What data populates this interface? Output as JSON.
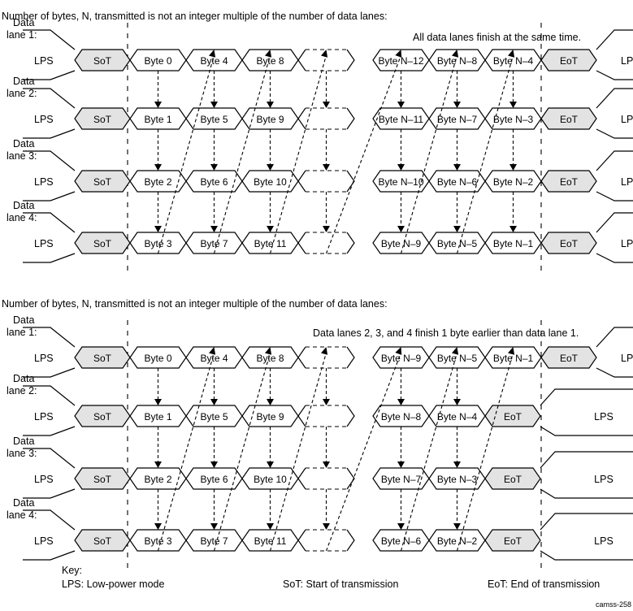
{
  "figure": {
    "id_label": "camss-258",
    "key_title": "Key:",
    "key_items": [
      "LPS: Low-power mode",
      "SoT: Start of transmission",
      "EoT: End of transmission"
    ]
  },
  "diagrams": [
    {
      "caption": "Number of bytes, N, transmitted is not an integer multiple of the number of data lanes:",
      "annotation": "All data lanes finish at the same time.",
      "lanes": [
        {
          "label_line1": "Data",
          "label_line2": "lane 1:",
          "lps_left": "LPS",
          "lps_right": "LPS",
          "sot": "SoT",
          "eot": "EoT",
          "bytes": [
            "Byte 0",
            "Byte 4",
            "Byte 8",
            "",
            "Byte N–12",
            "Byte N–8",
            "Byte N–4"
          ]
        },
        {
          "label_line1": "Data",
          "label_line2": "lane 2:",
          "lps_left": "LPS",
          "lps_right": "LPS",
          "sot": "SoT",
          "eot": "EoT",
          "bytes": [
            "Byte 1",
            "Byte 5",
            "Byte 9",
            "",
            "Byte N–11",
            "Byte N–7",
            "Byte N–3"
          ]
        },
        {
          "label_line1": "Data",
          "label_line2": "lane 3:",
          "lps_left": "LPS",
          "lps_right": "LPS",
          "sot": "SoT",
          "eot": "EoT",
          "bytes": [
            "Byte 2",
            "Byte 6",
            "Byte 10",
            "",
            "Byte N–10",
            "Byte N–6",
            "Byte N–2"
          ]
        },
        {
          "label_line1": "Data",
          "label_line2": "lane 4:",
          "lps_left": "LPS",
          "lps_right": "LPS",
          "sot": "SoT",
          "eot": "EoT",
          "bytes": [
            "Byte 3",
            "Byte 7",
            "Byte 11",
            "",
            "Byte N–9",
            "Byte N–5",
            "Byte N–1"
          ]
        }
      ]
    },
    {
      "caption": "Number of bytes, N, transmitted is not an integer multiple of the number of data lanes:",
      "annotation": "Data lanes 2, 3, and 4 finish 1 byte earlier than data lane 1.",
      "lanes": [
        {
          "label_line1": "Data",
          "label_line2": "lane 1:",
          "lps_left": "LPS",
          "lps_right": "LPS",
          "sot": "SoT",
          "eot": "EoT",
          "bytes": [
            "Byte 0",
            "Byte 4",
            "Byte 8",
            "",
            "Byte N–9",
            "Byte N–5",
            "Byte N–1"
          ]
        },
        {
          "label_line1": "Data",
          "label_line2": "lane 2:",
          "lps_left": "LPS",
          "lps_right": "LPS",
          "sot": "SoT",
          "eot": "EoT",
          "bytes": [
            "Byte 1",
            "Byte 5",
            "Byte 9",
            "",
            "Byte N–8",
            "Byte N–4"
          ]
        },
        {
          "label_line1": "Data",
          "label_line2": "lane 3:",
          "lps_left": "LPS",
          "lps_right": "LPS",
          "sot": "SoT",
          "eot": "EoT",
          "bytes": [
            "Byte 2",
            "Byte 6",
            "Byte 10",
            "",
            "Byte N–7",
            "Byte N–3"
          ]
        },
        {
          "label_line1": "Data",
          "label_line2": "lane 4:",
          "lps_left": "LPS",
          "lps_right": "LPS",
          "sot": "SoT",
          "eot": "EoT",
          "bytes": [
            "Byte 3",
            "Byte 7",
            "Byte 11",
            "",
            "Byte N–6",
            "Byte N–2"
          ]
        }
      ]
    }
  ]
}
